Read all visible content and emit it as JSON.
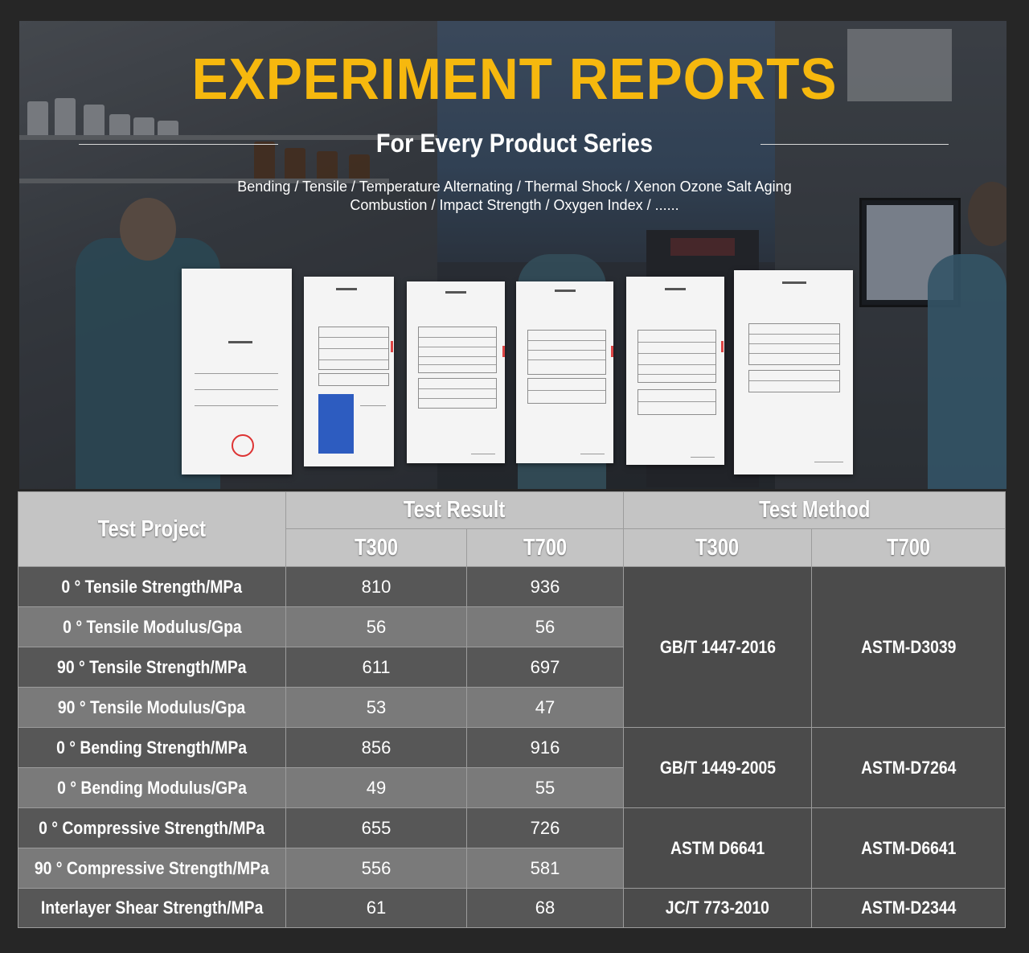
{
  "header": {
    "title": "EXPERIMENT REPORTS",
    "subtitle": "For Every Product Series",
    "desc_line1": "Bending / Tensile / Temperature Alternating / Thermal Shock / Xenon Ozone Salt Aging",
    "desc_line2": "Combustion / Impact Strength / Oxygen Index / ......",
    "accent_color": "#f6b80e"
  },
  "table": {
    "col_project": "Test Project",
    "group_result": "Test Result",
    "group_method": "Test Method",
    "sub_t300_result": "T300",
    "sub_t700_result": "T700",
    "sub_t300_method": "T300",
    "sub_t700_method": "T700",
    "rows": [
      {
        "project": "0 ° Tensile Strength/MPa",
        "t300": "810",
        "t700": "936"
      },
      {
        "project": "0 ° Tensile Modulus/Gpa",
        "t300": "56",
        "t700": "56"
      },
      {
        "project": "90 ° Tensile Strength/MPa",
        "t300": "611",
        "t700": "697"
      },
      {
        "project": "90 ° Tensile Modulus/Gpa",
        "t300": "53",
        "t700": "47"
      },
      {
        "project": "0 ° Bending Strength/MPa",
        "t300": "856",
        "t700": "916"
      },
      {
        "project": "0 ° Bending Modulus/GPa",
        "t300": "49",
        "t700": "55"
      },
      {
        "project": "0 ° Compressive Strength/MPa",
        "t300": "655",
        "t700": "726"
      },
      {
        "project": "90 ° Compressive Strength/MPa",
        "t300": "556",
        "t700": "581"
      },
      {
        "project": "Interlayer Shear Strength/MPa",
        "t300": "61",
        "t700": "68"
      }
    ],
    "methods": [
      {
        "t300": "GB/T 1447-2016",
        "t700": "ASTM-D3039"
      },
      {
        "t300": "GB/T 1449-2005",
        "t700": "ASTM-D7264"
      },
      {
        "t300": "ASTM D6641",
        "t700": "ASTM-D6641"
      },
      {
        "t300": "JC/T 773-2010",
        "t700": "ASTM-D2344"
      }
    ]
  }
}
